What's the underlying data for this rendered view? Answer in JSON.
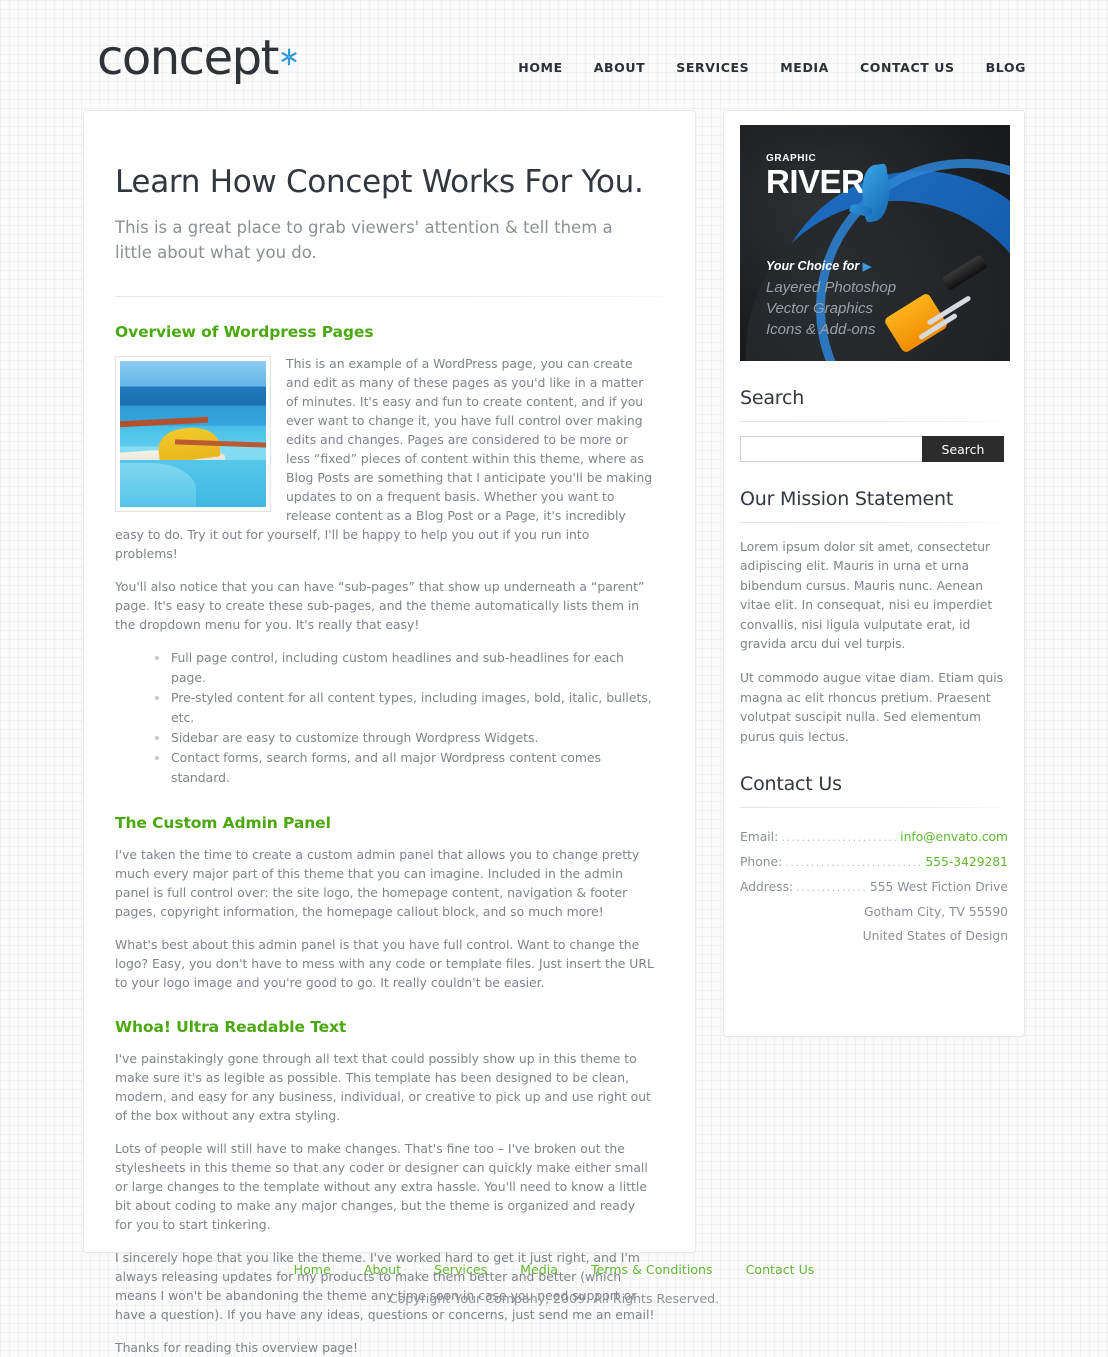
{
  "header": {
    "logo_text": "concept",
    "logo_accent_color": "#2e9bd6",
    "nav": [
      {
        "label": "HOME"
      },
      {
        "label": "ABOUT"
      },
      {
        "label": "SERVICES"
      },
      {
        "label": "MEDIA"
      },
      {
        "label": "CONTACT US"
      },
      {
        "label": "BLOG"
      }
    ]
  },
  "main": {
    "title": "Learn How Concept Works For You.",
    "subtitle": "This is a great place to grab viewers' attention & tell them a little about what you do.",
    "accent_green": "#4ba80e",
    "sections": [
      {
        "heading": "Overview of Wordpress Pages",
        "image_alt": "resort infinity pool overlooking the ocean",
        "paragraph1": "This is an example of a WordPress page, you can create and edit as many of these pages as you'd like in a matter of minutes. It's easy and fun to create content, and if you ever want to change it, you have full control over making edits and changes. Pages are considered to be more or less “fixed” pieces of content within this theme, where as Blog Posts are something that I anticipate you'll be making updates to on a frequent basis. Whether you want to release content as a Blog Post or a Page, it's incredibly easy to do. Try it out for yourself, I'll be happy to help you out if you run into problems!",
        "paragraph2": "You'll also notice that you can have “sub-pages” that show up underneath a “parent” page. It's easy to create these sub-pages, and the theme automatically lists them in the dropdown menu for you. It's really that easy!",
        "bullets": [
          "Full page control, including custom headlines and sub-headlines for each page.",
          "Pre-styled content for all content types, including images, bold, italic, bullets, etc.",
          "Sidebar are easy to customize through Wordpress Widgets.",
          "Contact forms, search forms, and all major Wordpress content comes standard."
        ]
      },
      {
        "heading": "The Custom Admin Panel",
        "paragraph1": "I've taken the time to create a custom admin panel that allows you to change pretty much every major part of this theme that you can imagine. Included in the admin panel is full control over: the site logo, the homepage content, navigation & footer pages, copyright information, the homepage callout block, and so much more!",
        "paragraph2": "What's best about this admin panel is that you have full control. Want to change the logo? Easy, you don't have to mess with any code or template files. Just insert the URL to your logo image and you're good to go. It really couldn't be easier."
      },
      {
        "heading": "Whoa! Ultra Readable Text",
        "paragraph1": "I've painstakingly gone through all text that could possibly show up in this theme to make sure it's as legible as possible. This template has been designed to be clean, modern, and easy for any business, individual, or creative to pick up and use right out of the box without any extra styling.",
        "paragraph2": "Lots of people will still have to make changes. That's fine too – I've broken out the stylesheets in this theme so that any coder or designer can quickly make either small or large changes to the template without any extra hassle. You'll need to know a little bit about coding to make any major changes, but the theme is organized and ready for you to start tinkering.",
        "paragraph3": "I sincerely hope that you like the theme. I've worked hard to get it just right, and I'm always releasing updates for my products to make them better and better (which means I won't be abandoning the theme any time soon in case you need support or have a question). If you have any ideas, questions or concerns, just send me an email!",
        "paragraph4": "Thanks for reading this overview page!"
      }
    ]
  },
  "sidebar": {
    "banner": {
      "brand_small": "GRAPHIC",
      "brand_large": "RIVER",
      "tagline_line1": "Your Choice for",
      "tagline_arrow": "▶",
      "tagline_line2": "Layered Photoshop",
      "tagline_line3": "Vector Graphics",
      "tagline_line4": "Icons & Add-ons"
    },
    "search": {
      "title": "Search",
      "value": "",
      "placeholder": "",
      "button_label": "Search"
    },
    "mission": {
      "title": "Our Mission Statement",
      "paragraph1": "Lorem ipsum dolor sit amet, consectetur adipiscing elit. Mauris in urna et urna bibendum cursus. Mauris nunc. Aenean vitae elit. In consequat, nisi eu imperdiet convallis, nisi ligula vulputate erat, id gravida arcu dui vel turpis.",
      "paragraph2": "Ut commodo augue vitae diam. Etiam quis magna ac elit rhoncus pretium. Praesent volutpat suscipit nulla. Sed elementum purus quis lectus."
    },
    "contact": {
      "title": "Contact Us",
      "rows": [
        {
          "label": "Email:",
          "value": "info@envato.com",
          "style": "green"
        },
        {
          "label": "Phone:",
          "value": "555-3429281",
          "style": "green"
        },
        {
          "label": "Address:",
          "value": "555 West Fiction Drive",
          "style": "gray"
        }
      ],
      "address_line2": "Gotham City, TV 55590",
      "address_line3": "United States of Design"
    }
  },
  "footer": {
    "links": [
      {
        "label": "Home"
      },
      {
        "label": "About"
      },
      {
        "label": "Services"
      },
      {
        "label": "Media"
      },
      {
        "label": "Terms & Conditions"
      },
      {
        "label": "Contact Us"
      }
    ],
    "copyright": "Copyright Your Company, 2009. All Rights Reserved.",
    "link_color": "#63b832"
  }
}
